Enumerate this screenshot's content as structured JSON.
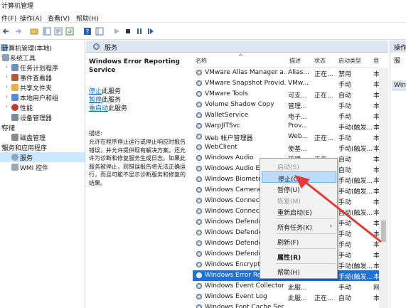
{
  "window": {
    "title": "计算机管理"
  },
  "menu": {
    "items": [
      "件(F)",
      "操作(A)",
      "查看(V)",
      "帮助(H)"
    ]
  },
  "tree": {
    "items": [
      {
        "label": "计算机管理(本地)",
        "level": 0,
        "twisty": ""
      },
      {
        "label": "系统工具",
        "level": 1,
        "twisty": "▾"
      },
      {
        "label": "任务计划程序",
        "level": 2,
        "twisty": "›"
      },
      {
        "label": "事件查看器",
        "level": 2,
        "twisty": "›"
      },
      {
        "label": "共享文件夹",
        "level": 2,
        "twisty": "›"
      },
      {
        "label": "本地用户和组",
        "level": 2,
        "twisty": "›"
      },
      {
        "label": "性能",
        "level": 2,
        "twisty": "›"
      },
      {
        "label": "设备管理器",
        "level": 2,
        "twisty": ""
      },
      {
        "label": "存储",
        "level": 1,
        "twisty": "▾"
      },
      {
        "label": "磁盘管理",
        "level": 2,
        "twisty": ""
      },
      {
        "label": "服务和应用程序",
        "level": 1,
        "twisty": "▾"
      },
      {
        "label": "服务",
        "level": 2,
        "twisty": ""
      },
      {
        "label": "WMI 控件",
        "level": 2,
        "twisty": ""
      }
    ]
  },
  "panel": {
    "header": "服务"
  },
  "description": {
    "service_title": "Windows Error Reporting Service",
    "link1": "停止",
    "link1_suffix": "此服务",
    "link2": "暂停",
    "link2_suffix": "此服务",
    "link3": "重启动",
    "link3_suffix": "此服务",
    "desc_label": "描述:",
    "desc_text": "允许在程序停止运行或停止响应时报告错误，并允许提供现有解决方案。还允许为诊断和修复服务生成日志。如果此服务被停止，则错误报告将无法正确运行，而且可能不显示诊断服务和修复的结果。"
  },
  "columns": [
    "名称",
    "描述",
    "状态",
    "启动类型",
    "登"
  ],
  "services": [
    {
      "name": "VMware Alias Manager a...",
      "desc": "Alias...",
      "status": "正在...",
      "start": "禁用",
      "logon": "本"
    },
    {
      "name": "VMware Snapshot Provid...",
      "desc": "VMw...",
      "status": "",
      "start": "手动",
      "logon": "本"
    },
    {
      "name": "VMware Tools",
      "desc": "可支...",
      "status": "正在...",
      "start": "自动",
      "logon": "本"
    },
    {
      "name": "Volume Shadow Copy",
      "desc": "管理...",
      "status": "",
      "start": "手动",
      "logon": "本"
    },
    {
      "name": "WalletService",
      "desc": "电子...",
      "status": "",
      "start": "手动",
      "logon": "本"
    },
    {
      "name": "WarpJITSvc",
      "desc": "Prov...",
      "status": "",
      "start": "手动(触发...",
      "logon": "本"
    },
    {
      "name": "Web 帐户管理器",
      "desc": "Web...",
      "status": "正在...",
      "start": "手动",
      "logon": "本"
    },
    {
      "name": "WebClient",
      "desc": "使基...",
      "status": "",
      "start": "手动(触发...",
      "logon": "本"
    },
    {
      "name": "Windows Audio",
      "desc": "管理...",
      "status": "正在...",
      "start": "自动",
      "logon": "本"
    },
    {
      "name": "Windows Audio En",
      "desc": "",
      "status": "",
      "start": "自动",
      "logon": "本"
    },
    {
      "name": "Windows Biometri",
      "desc": "",
      "status": "",
      "start": "手动(触发...",
      "logon": "本"
    },
    {
      "name": "Windows Camera",
      "desc": "",
      "status": "",
      "start": "手动(触发...",
      "logon": "本"
    },
    {
      "name": "Windows Connect",
      "desc": "",
      "status": "",
      "start": "手动",
      "logon": "本"
    },
    {
      "name": "Windows Connecti",
      "desc": "",
      "status": "",
      "start": "自动(触发...",
      "logon": "本"
    },
    {
      "name": "Windows Defende",
      "desc": "",
      "status": "",
      "start": "手动",
      "logon": "本"
    },
    {
      "name": "Windows Defende",
      "desc": "",
      "status": "",
      "start": "手动",
      "logon": "本"
    },
    {
      "name": "Windows Defende",
      "desc": "",
      "status": "",
      "start": "手动",
      "logon": "本"
    },
    {
      "name": "Windows Defende",
      "desc": "",
      "status": "",
      "start": "手动",
      "logon": "本"
    },
    {
      "name": "Windows Encryptio",
      "desc": "",
      "status": "",
      "start": "手动(触发...",
      "logon": "本"
    },
    {
      "name": "Windows Error Re",
      "desc": "",
      "status": "",
      "start": "手动(触发...",
      "logon": "本",
      "selected": true
    },
    {
      "name": "Windows Event Collector",
      "desc": "此服...",
      "status": "",
      "start": "手动",
      "logon": "网"
    },
    {
      "name": "Windows Event Log",
      "desc": "此服...",
      "status": "正在...",
      "start": "自动",
      "logon": "本"
    },
    {
      "name": "Windows Font Cache Ser...",
      "desc": "",
      "status": "",
      "start": "",
      "logon": ""
    }
  ],
  "context_menu": {
    "items": [
      {
        "label": "启动(S)",
        "state": "disabled"
      },
      {
        "label": "停止(O)",
        "state": "highlight"
      },
      {
        "label": "暂停(U)",
        "state": "normal"
      },
      {
        "label": "恢复(M)",
        "state": "disabled"
      },
      {
        "label": "重新启动(E)",
        "state": "normal"
      },
      {
        "label": "所有任务(K)",
        "state": "normal",
        "submenu": true
      },
      {
        "label": "刷新(F)",
        "state": "normal"
      },
      {
        "label": "属性(R)",
        "state": "bold"
      },
      {
        "label": "帮助(H)",
        "state": "normal"
      }
    ]
  },
  "actions": {
    "header": "操作",
    "item1": "服",
    "item2": "Win"
  },
  "colors": {
    "accent": "#1f6fd6",
    "arrow": "#e53935",
    "header_bg": "#dde7f3",
    "menu_highlight": "#bcdcff"
  }
}
